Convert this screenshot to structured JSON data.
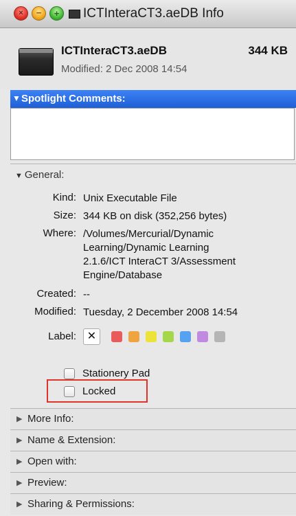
{
  "window": {
    "title": "ICTInteraCT3.aeDB Info"
  },
  "header": {
    "file_name": "ICTInteraCT3.aeDB",
    "file_size": "344 KB",
    "modified": "Modified: 2 Dec 2008 14:54"
  },
  "spotlight": {
    "label": "Spotlight Comments:",
    "value": ""
  },
  "general": {
    "label": "General:",
    "kind_label": "Kind:",
    "kind": "Unix Executable File",
    "size_label": "Size:",
    "size": "344 KB on disk (352,256 bytes)",
    "where_label": "Where:",
    "where_lines": [
      "/Volumes/Mercurial/Dynamic",
      "Learning/Dynamic Learning",
      "2.1.6/ICT InteraCT 3/Assessment",
      "Engine/Database"
    ],
    "created_label": "Created:",
    "created": "--",
    "modified_label": "Modified:",
    "modified": "Tuesday, 2 December 2008 14:54",
    "label_label": "Label:",
    "label_none": "✕",
    "label_colors": [
      "#e95a5a",
      "#f0a440",
      "#ece23a",
      "#a4d84a",
      "#57a2f0",
      "#c08ae0",
      "#b5b5b5"
    ],
    "stationery_pad": "Stationery Pad",
    "stationery_checked": false,
    "locked": "Locked",
    "locked_checked": false
  },
  "sections": [
    "More Info:",
    "Name & Extension:",
    "Open with:",
    "Preview:",
    "Sharing & Permissions:"
  ],
  "colors": {
    "highlight": "#e0342a",
    "spotlight_header": "#2a6ae0"
  }
}
